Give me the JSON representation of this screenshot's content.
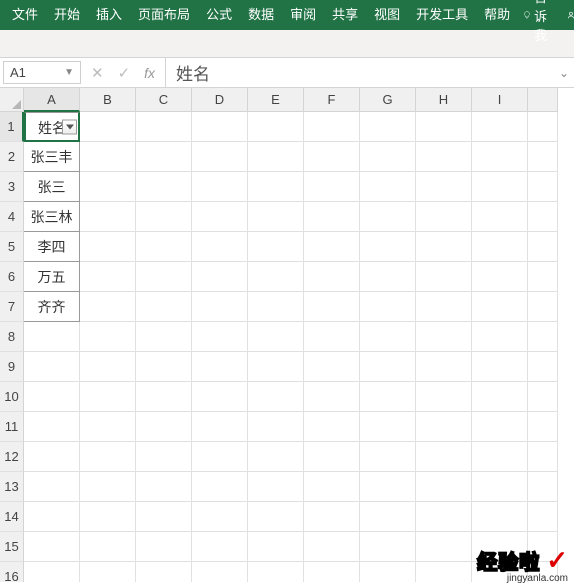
{
  "ribbon": {
    "tabs": [
      "文件",
      "开始",
      "插入",
      "页面布局",
      "公式",
      "数据",
      "审阅",
      "共享",
      "视图",
      "开发工具",
      "帮助"
    ],
    "tellme": "告诉我",
    "share": "共享"
  },
  "formula_bar": {
    "name_box": "A1",
    "fx": "fx",
    "value": "姓名"
  },
  "columns": [
    "A",
    "B",
    "C",
    "D",
    "E",
    "F",
    "G",
    "H",
    "I"
  ],
  "rows": [
    "1",
    "2",
    "3",
    "4",
    "5",
    "6",
    "7",
    "8",
    "9",
    "10",
    "11",
    "12",
    "13",
    "14",
    "15",
    "16"
  ],
  "data_col_a": [
    "姓名",
    "张三丰",
    "张三",
    "张三林",
    "李四",
    "万五",
    "齐齐"
  ],
  "watermark": {
    "text": "经验啦",
    "url": "jingyanla.com"
  }
}
